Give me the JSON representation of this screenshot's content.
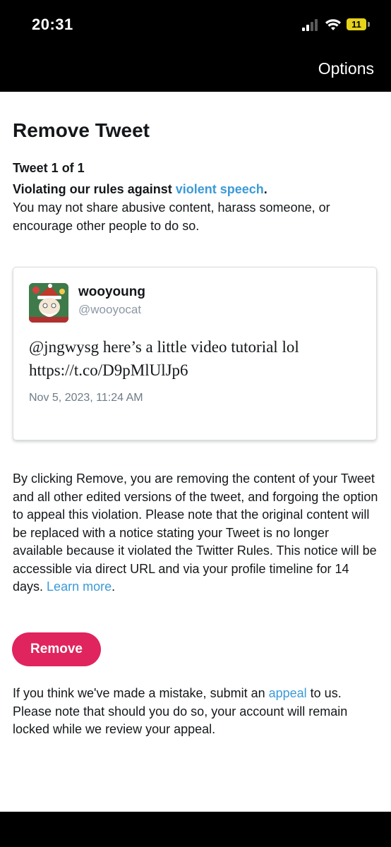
{
  "status_bar": {
    "time": "20:31",
    "battery": "11",
    "battery_color": "#e5d21a"
  },
  "nav": {
    "options_label": "Options"
  },
  "page": {
    "title": "Remove Tweet",
    "tweet_count": "Tweet 1 of 1",
    "violation_prefix": "Violating our rules against ",
    "violation_link": "violent speech",
    "violation_suffix": ".",
    "violation_description": "You may not share abusive content, harass someone, or encourage other people to do so."
  },
  "tweet": {
    "display_name": "wooyoung",
    "handle": "@wooyocat",
    "text_line1": "@jngwysg here’s a little video tutorial lol",
    "text_line2": "https://t.co/D9pMlUlJp6",
    "date": "Nov 5, 2023, 11:24 AM"
  },
  "explanation": {
    "text": "By clicking Remove, you are removing the content of your Tweet and all other edited versions of the tweet, and forgoing the option to appeal this violation. Please note that the original content will be replaced with a notice stating your Tweet is no longer available because it violated the Twitter Rules. This notice will be accessible via direct URL and via your profile timeline for 14 days.",
    "learn_more": "Learn more",
    "learn_more_suffix": "."
  },
  "actions": {
    "remove_label": "Remove"
  },
  "appeal": {
    "prefix": "If you think we've made a mistake, submit an ",
    "link": "appeal",
    "suffix": " to us. Please note that should you do so, your account will remain locked while we review your appeal."
  },
  "colors": {
    "link": "#3b9ad8",
    "remove_button": "#e0245e",
    "top_bar": "#000000"
  }
}
